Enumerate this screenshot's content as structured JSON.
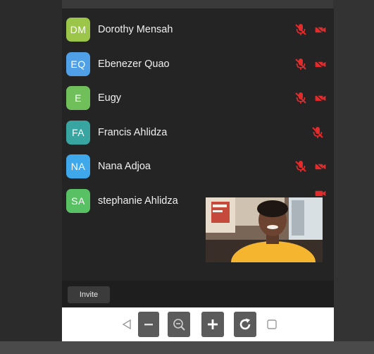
{
  "participants": [
    {
      "initials": "DM",
      "name": "Dorothy Mensah",
      "color": "#9cc64a",
      "mic": "muted",
      "cam": "off"
    },
    {
      "initials": "EQ",
      "name": "Ebenezer Quao",
      "color": "#4fa0e6",
      "mic": "muted",
      "cam": "off"
    },
    {
      "initials": "E",
      "name": "Eugy",
      "color": "#6fbf5a",
      "mic": "muted",
      "cam": "off"
    },
    {
      "initials": "FA",
      "name": "Francis Ahlidza",
      "color": "#38a5a0",
      "mic": "muted",
      "cam": "none"
    },
    {
      "initials": "NA",
      "name": "Nana Adjoa",
      "color": "#3fa8ea",
      "mic": "muted",
      "cam": "off"
    },
    {
      "initials": "SA",
      "name": "stephanie Ahlidza",
      "color": "#58c164",
      "mic": "muted",
      "cam": "off"
    }
  ],
  "footer": {
    "invite_label": "Invite"
  },
  "colors": {
    "muted_red": "#e32b2b",
    "panel_bg": "#242424"
  },
  "toolbar": {
    "icons": [
      "back-triangle-icon",
      "minus-icon",
      "zoom-out-icon",
      "plus-icon",
      "refresh-icon",
      "square-icon"
    ]
  }
}
